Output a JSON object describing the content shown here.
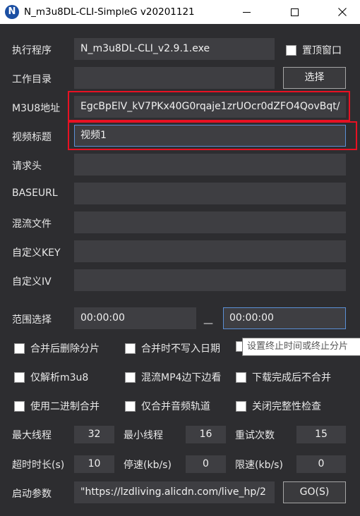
{
  "window": {
    "title": "N_m3u8DL-CLI-SimpleG v20201121",
    "icon_letter": "N"
  },
  "labels": {
    "exe": "执行程序",
    "workdir": "工作目录",
    "m3u8": "M3U8地址",
    "title": "视频标题",
    "headers": "请求头",
    "baseurl": "BASEURL",
    "mux": "混流文件",
    "key": "自定义KEY",
    "iv": "自定义IV",
    "range": "范围选择",
    "max_threads": "最大线程",
    "min_threads": "最小线程",
    "retries": "重试次数",
    "timeout": "超时时长(s)",
    "stop_speed": "停速(kb/s)",
    "limit_speed": "限速(kb/s)",
    "launch_args": "启动参数"
  },
  "fields": {
    "exe": "N_m3u8DL-CLI_v2.9.1.exe",
    "workdir": "",
    "m3u8": "EgcBpElV_kV7PKx40G0rqaje1zrUOcr0dZFO4QovBqt/",
    "title": "视频1",
    "headers": "",
    "baseurl": "",
    "mux": "",
    "key": "",
    "iv": "",
    "range_start": "00:00:00",
    "range_end": "00:00:00",
    "max_threads": "32",
    "min_threads": "16",
    "retries": "15",
    "timeout": "10",
    "stop_speed": "0",
    "limit_speed": "0",
    "launch_args": "\"https://lzdliving.alicdn.com/live_hp/2"
  },
  "buttons": {
    "select": "选择",
    "go": "GO(S)"
  },
  "range_separator": "—",
  "checkboxes": {
    "topmost": {
      "label": "置顶窗口",
      "checked": false
    },
    "delete_after_merge": {
      "label": "合并后删除分片",
      "checked": false
    },
    "no_date_on_merge": {
      "label": "合并时不写入日期",
      "checked": false
    },
    "set_end": {
      "label": "",
      "checked": false
    },
    "parse_only": {
      "label": "仅解析m3u8",
      "checked": false
    },
    "mux_mp4": {
      "label": "混流MP4边下边看",
      "checked": false
    },
    "no_merge": {
      "label": "下载完成后不合并",
      "checked": false
    },
    "binary_merge": {
      "label": "使用二进制合并",
      "checked": false
    },
    "audio_only": {
      "label": "仅合并音频轨道",
      "checked": false
    },
    "no_integrity": {
      "label": "关闭完整性检查",
      "checked": false
    }
  },
  "tooltip": "设置终止时间或终止分片",
  "colors": {
    "background": "#2d2d30",
    "input": "#3e3e42",
    "highlight": "#e81123",
    "focus_border": "#5b8fd6"
  }
}
